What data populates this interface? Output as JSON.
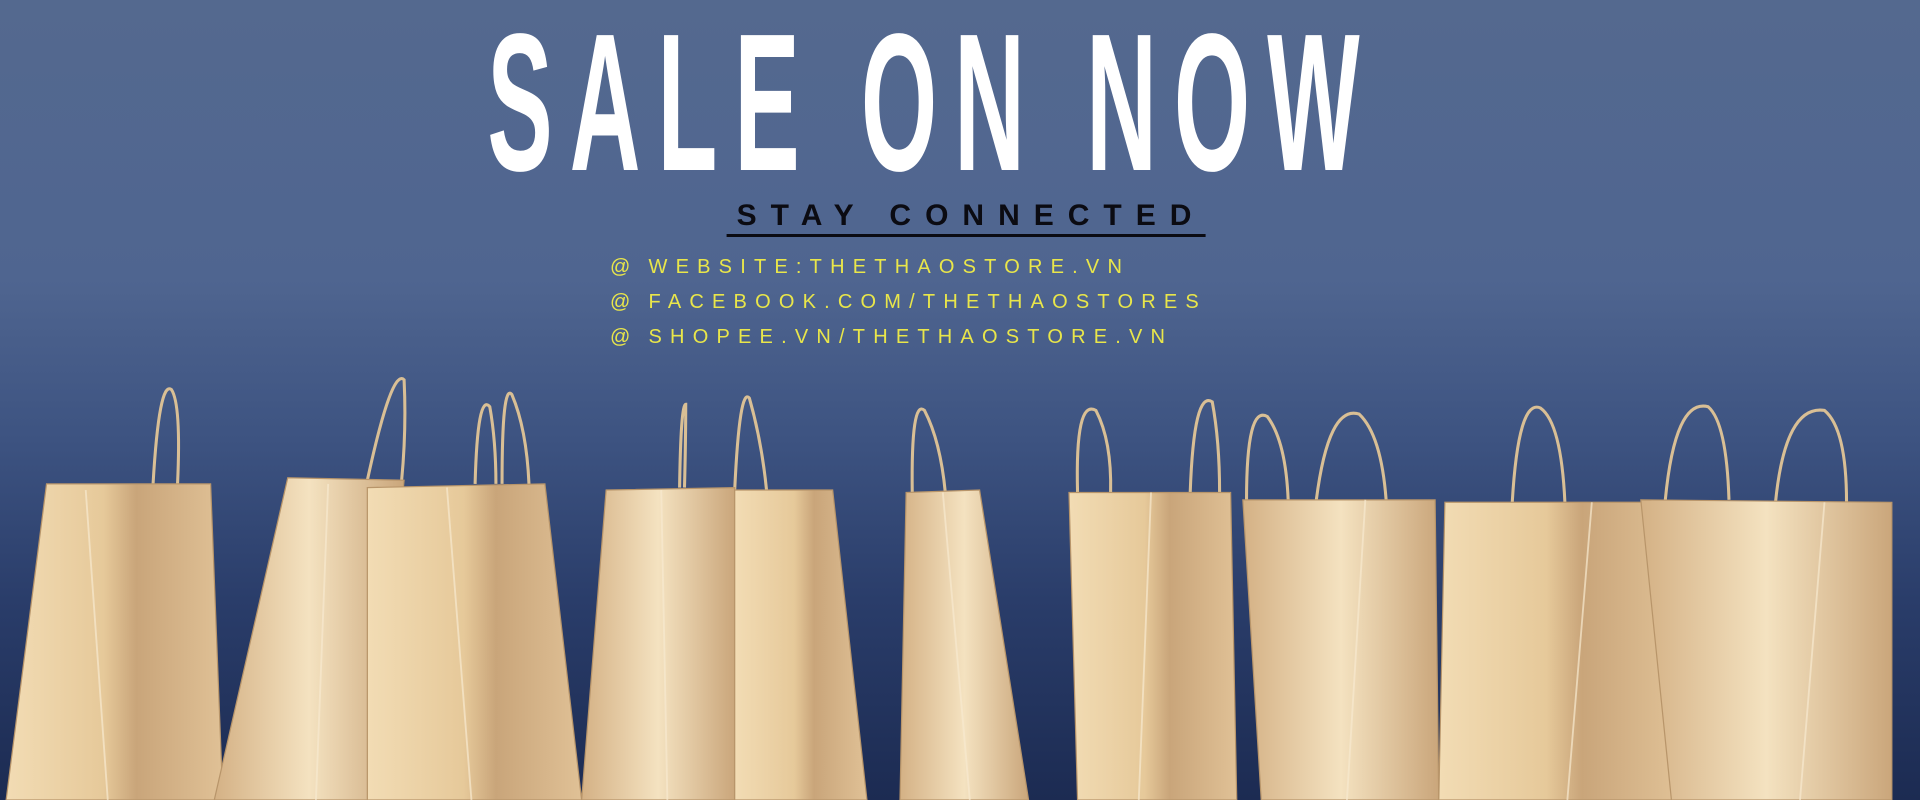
{
  "banner": {
    "title": "SALE ON NOW",
    "subtitle": "STAY CONNECTED",
    "links": [
      {
        "icon": "at-icon",
        "prefix": "@",
        "text": "WEBSITE:THETHAOSTORE.VN"
      },
      {
        "icon": "at-icon",
        "prefix": "@",
        "text": "FACEBOOK.COM/THETHAOSTORES"
      },
      {
        "icon": "at-icon",
        "prefix": "@",
        "text": "SHOPEE.VN/THETHAOSTORE.VN"
      }
    ]
  },
  "colors": {
    "background": "#4f6590",
    "title": "#ffffff",
    "subtitle": "#0b0b12",
    "links": "#e9e64a",
    "bag": "#d9bd92"
  }
}
